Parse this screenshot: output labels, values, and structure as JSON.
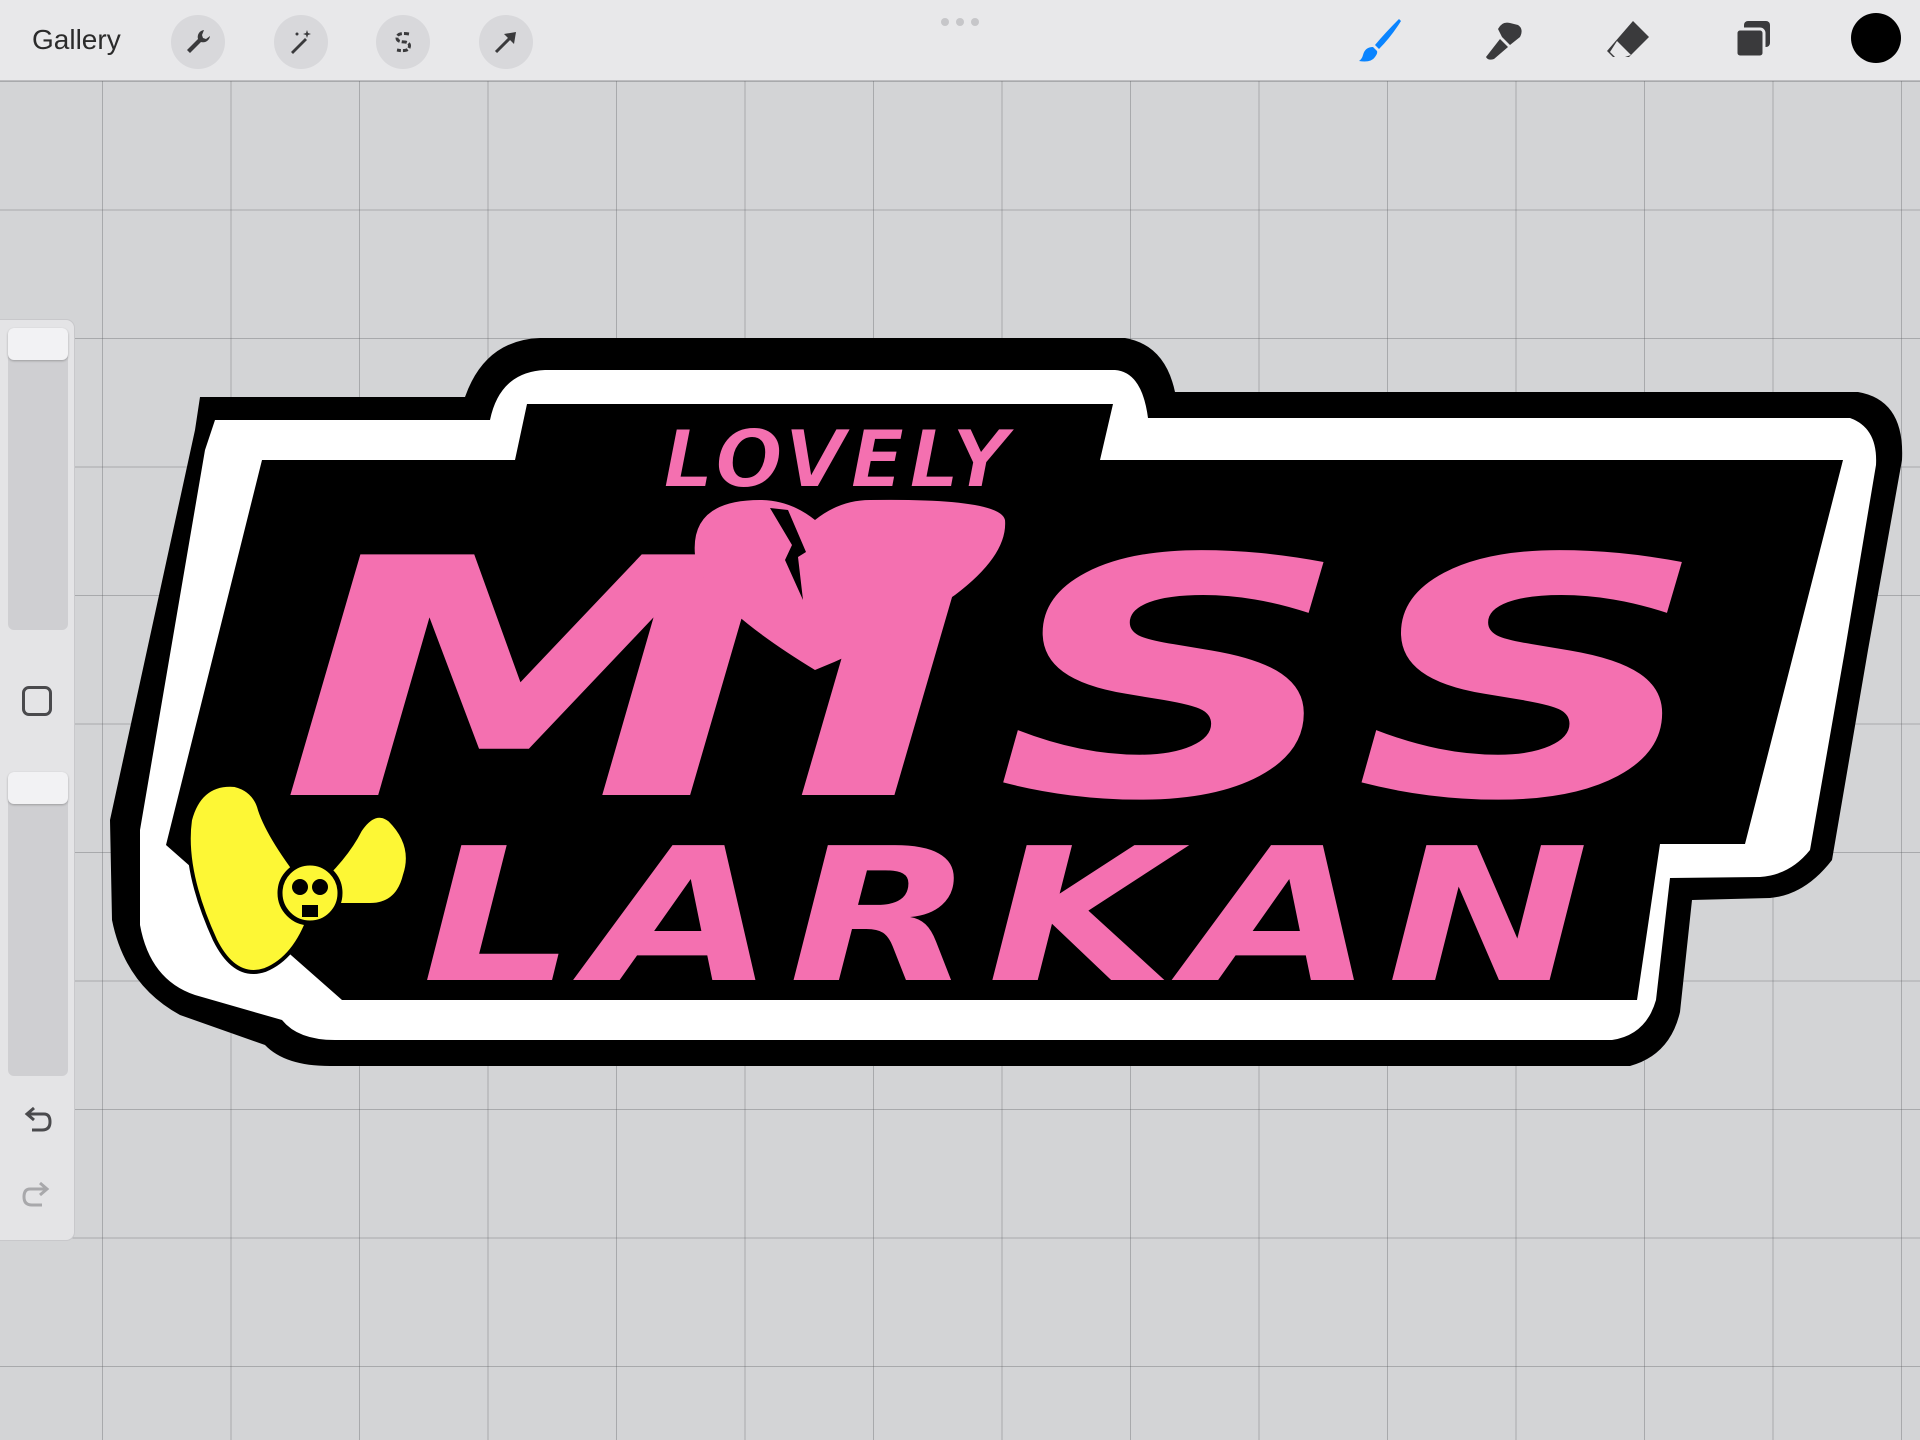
{
  "toolbar": {
    "gallery_label": "Gallery",
    "left_tools": [
      "wrench-icon",
      "magic-wand-icon",
      "selection-icon",
      "transform-arrow-icon"
    ],
    "right_tools": [
      "brush-icon",
      "smudge-icon",
      "eraser-icon",
      "layers-icon"
    ],
    "active_tool": "brush-icon",
    "active_color": "#0a84ff",
    "current_color": "#000000"
  },
  "artwork": {
    "line1": "LOVELY",
    "line2": "MISS",
    "line3": "LARKAN",
    "colors": {
      "pink": "#f470b0",
      "black": "#000000",
      "white": "#ffffff",
      "yellow": "#fdf735"
    }
  },
  "sidebar": {
    "controls": [
      "brush-size-slider",
      "modify-button",
      "opacity-slider",
      "undo-icon",
      "redo-icon"
    ]
  }
}
